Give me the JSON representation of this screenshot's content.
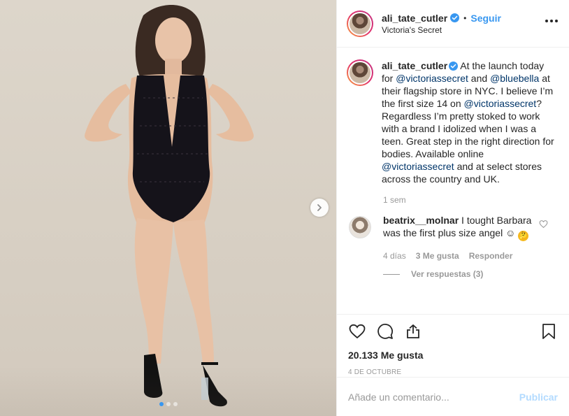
{
  "post": {
    "username": "ali_tate_cutler",
    "follow_label": "Seguir",
    "separator": "•",
    "location": "Victoria's Secret",
    "caption": {
      "username": "ali_tate_cutler",
      "seg1": " At the launch today for ",
      "mention1": "@victoriassecret",
      "seg2": " and ",
      "mention2": "@bluebella",
      "seg3": " at their flagship store in NYC. I believe I’m the first size 14 on ",
      "mention3": "@victoriassecret",
      "seg4": "? Regardless I’m pretty stoked to work with a brand I idolized when I was a teen. Great step in the right direction for bodies. Available online ",
      "mention4": "@victoriassecret",
      "seg5": " and at select stores across the country and UK.",
      "time": "1 sem"
    },
    "comment": {
      "username": "beatrix__molnar",
      "text": " I tought Barbara was the first plus size angel ☺",
      "emoji": "🤔",
      "time": "4 días",
      "likes": "3 Me gusta",
      "reply_label": "Responder",
      "view_replies": "Ver respuestas (3)"
    },
    "likes_count": "20.133 Me gusta",
    "date": "4 de octubre",
    "comment_placeholder": "Añade un comentario...",
    "publish_label": "Publicar",
    "carousel": {
      "slides": 3,
      "current": 1
    }
  },
  "colors": {
    "link": "#3897f0",
    "mention": "#003569",
    "muted": "#999999",
    "publish_disabled": "#b3dbff"
  },
  "icons": [
    "verified-icon",
    "more-options-icon",
    "heart-icon",
    "comment-icon",
    "share-icon",
    "bookmark-icon",
    "chevron-right-icon"
  ]
}
